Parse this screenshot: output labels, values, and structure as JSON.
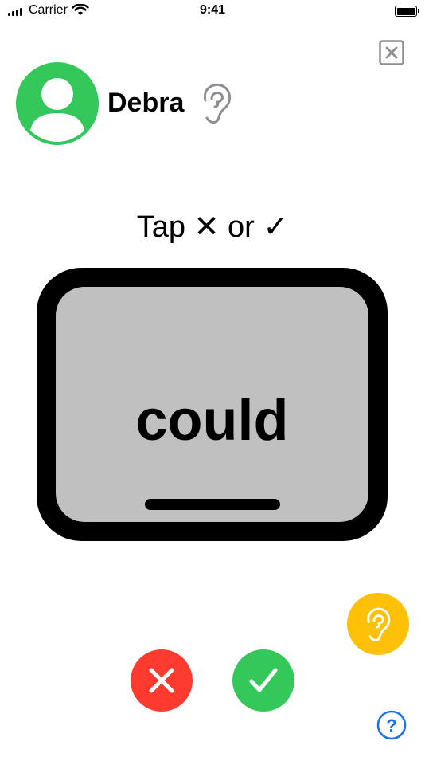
{
  "status_bar": {
    "carrier": "Carrier",
    "time": "9:41"
  },
  "header": {
    "user_name": "Debra",
    "avatar_color": "#34c759",
    "close_icon": "close-box-icon",
    "ear_icon": "ear-icon"
  },
  "prompt": {
    "instruction": "Tap ✕ or ✓"
  },
  "card": {
    "word": "could"
  },
  "controls": {
    "listen_icon": "ear-icon",
    "listen_color": "#ffc107",
    "wrong_icon": "x-icon",
    "wrong_color": "#ff3b30",
    "right_icon": "checkmark-icon",
    "right_color": "#34c759",
    "help_label": "?",
    "help_color": "#1a73e8"
  }
}
